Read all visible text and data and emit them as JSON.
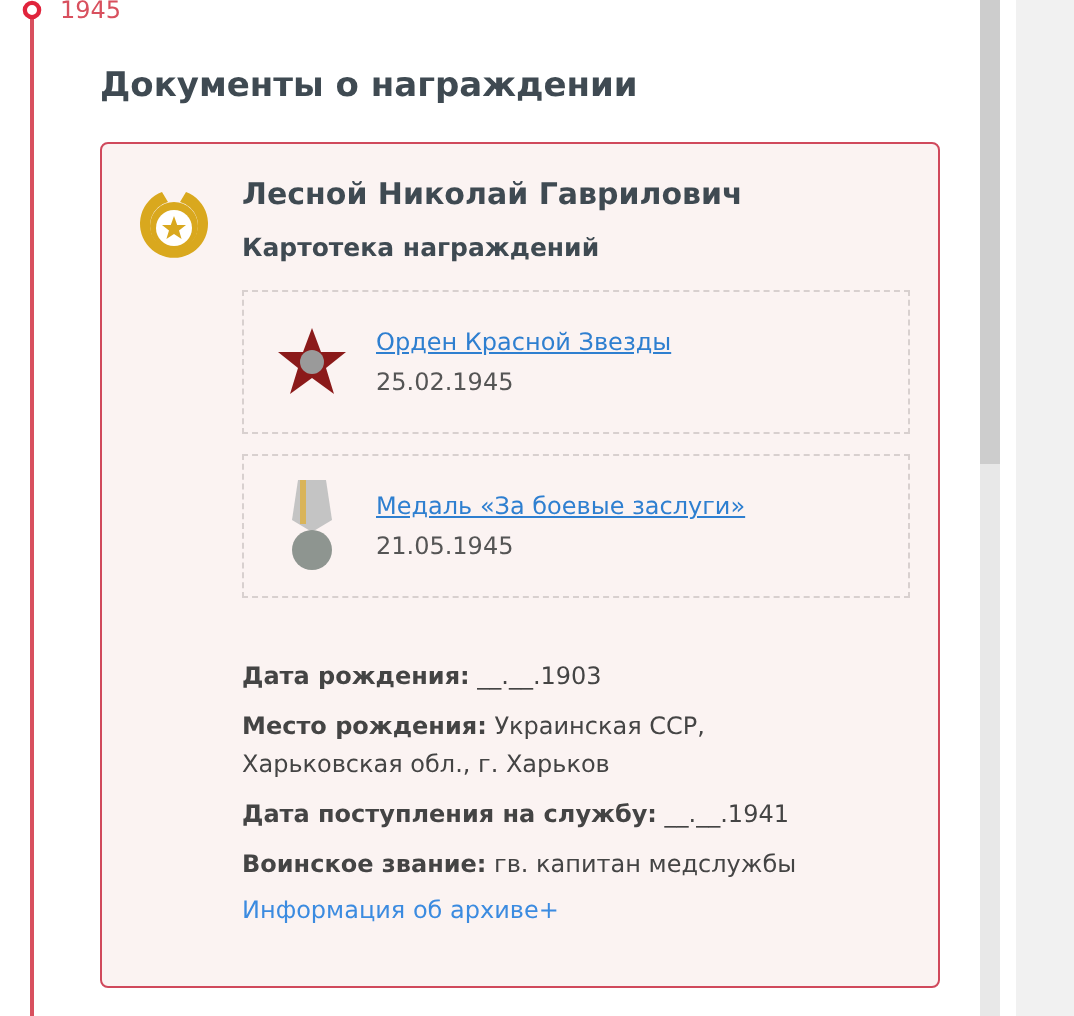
{
  "timeline": {
    "year": "1945"
  },
  "section": {
    "title": "Документы о награждении"
  },
  "card": {
    "name": "Лесной Николай Гаврилович",
    "subtitle": "Картотека награждений",
    "awards": [
      {
        "kind": "star",
        "title": "Орден Красной Звезды",
        "date": "25.02.1945"
      },
      {
        "kind": "medal",
        "title": "Медаль «За боевые заслуги»",
        "date": "21.05.1945"
      }
    ],
    "facts": [
      "**Дата рождения:** __.__.1903",
      "**Место рождения:** Украинская ССР, Харьковская обл., г. Харьков",
      "**Дата поступления на службу:** __.__.1941",
      "**Воинское звание:** гв. капитан медслужбы"
    ],
    "archive_link": "Информация об архиве+"
  }
}
